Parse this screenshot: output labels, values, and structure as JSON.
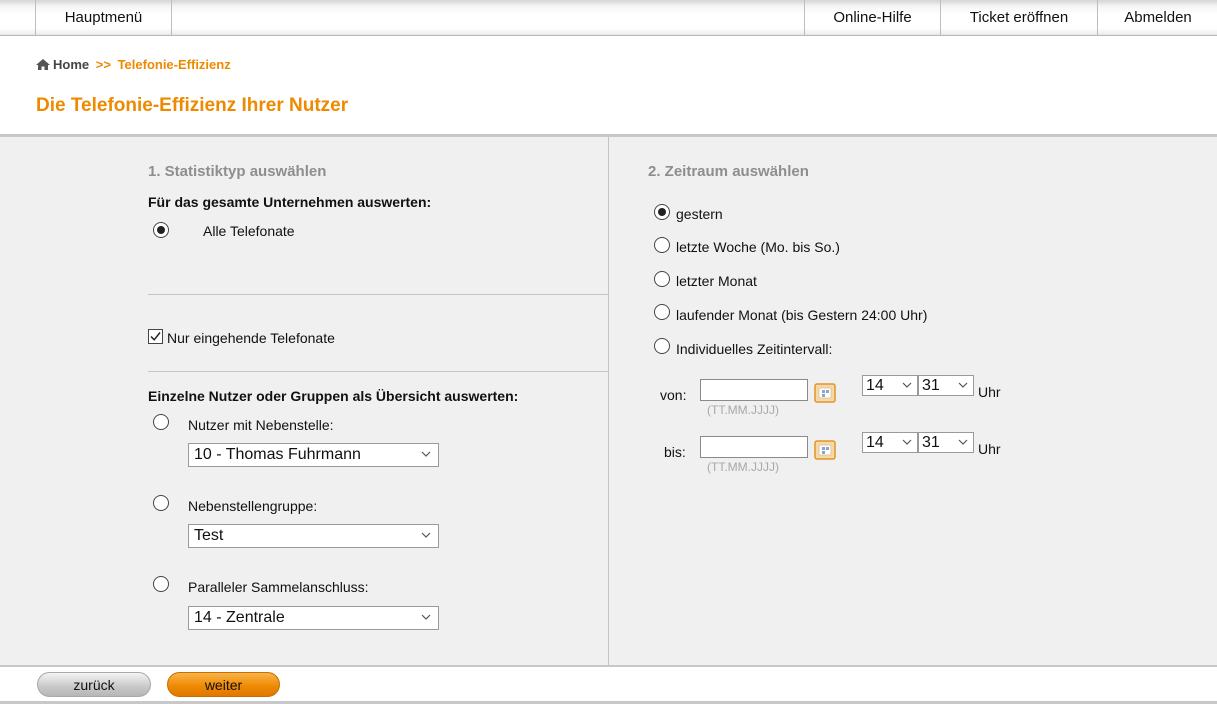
{
  "nav": {
    "main_menu": "Hauptmenü",
    "help": "Online-Hilfe",
    "ticket": "Ticket eröffnen",
    "logout": "Abmelden"
  },
  "breadcrumb": {
    "home": "Home",
    "separator": ">>",
    "current": "Telefonie-Effizienz"
  },
  "page_title": "Die Telefonie-Effizienz Ihrer Nutzer",
  "section1": {
    "title": "1. Statistiktyp auswählen",
    "company_label": "Für das gesamte Unternehmen auswerten:",
    "all_calls": {
      "label": "Alle Telefonate",
      "checked": true
    },
    "incoming_only": {
      "label": "Nur eingehende Telefonate",
      "checked": true
    },
    "individual_label": "Einzelne Nutzer oder Gruppen als Übersicht auswerten:",
    "user_ext": {
      "label": "Nutzer mit Nebenstelle:",
      "selected": "10 - Thomas Fuhrmann"
    },
    "ext_group": {
      "label": "Nebenstellengruppe:",
      "selected": "Test"
    },
    "parallel_hunt": {
      "label": "Paralleler Sammelanschluss:",
      "selected": "14 - Zentrale"
    }
  },
  "section2": {
    "title": "2. Zeitraum auswählen",
    "options": [
      {
        "label": "gestern",
        "checked": true
      },
      {
        "label": "letzte Woche (Mo. bis So.)",
        "checked": false
      },
      {
        "label": "letzter Monat",
        "checked": false
      },
      {
        "label": "laufender Monat (bis Gestern 24:00 Uhr)",
        "checked": false
      },
      {
        "label": "Individuelles Zeitintervall:",
        "checked": false
      }
    ],
    "from": {
      "label": "von:",
      "value": "",
      "hint": "(TT.MM.JJJJ)",
      "hour": "14",
      "minute": "31",
      "unit": "Uhr"
    },
    "to": {
      "label": "bis:",
      "value": "",
      "hint": "(TT.MM.JJJJ)",
      "hour": "14",
      "minute": "31",
      "unit": "Uhr"
    }
  },
  "buttons": {
    "back": "zurück",
    "next": "weiter"
  },
  "colors": {
    "accent": "#ee8a00",
    "panel_bg": "#f0f0f0",
    "section_title": "#8e8e8e"
  }
}
